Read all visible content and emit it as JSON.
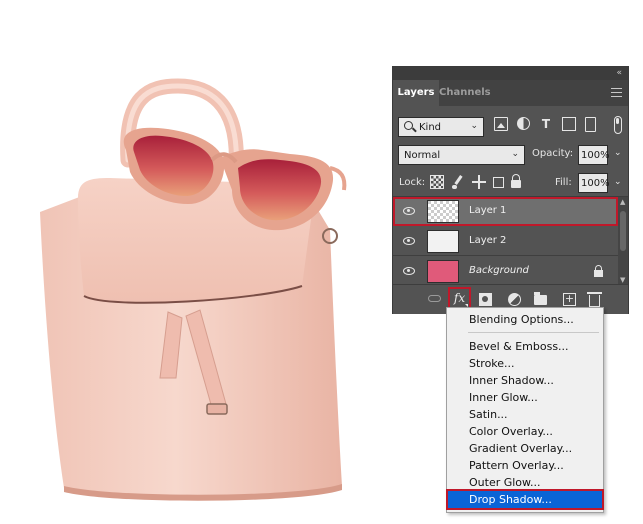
{
  "panel": {
    "tabs": [
      {
        "label": "Layers",
        "active": true
      },
      {
        "label": "Channels",
        "active": false
      }
    ]
  },
  "filter": {
    "kind_label": "Kind"
  },
  "blend": {
    "mode": "Normal",
    "opacity_label": "Opacity:",
    "opacity_value": "100%"
  },
  "lock": {
    "label": "Lock:",
    "fill_label": "Fill:",
    "fill_value": "100%"
  },
  "layers": [
    {
      "name": "Layer 1",
      "selected": true,
      "thumbnail": "transparent-checker"
    },
    {
      "name": "Layer 2",
      "selected": false,
      "thumbnail": "white"
    },
    {
      "name": "Background",
      "selected": false,
      "thumbnail": "pink-photo",
      "locked": true
    }
  ],
  "bottom_bar": {
    "fx_label": "fx"
  },
  "fx_menu": {
    "items": [
      "Blending Options...",
      "Bevel & Emboss...",
      "Stroke...",
      "Inner Shadow...",
      "Inner Glow...",
      "Satin...",
      "Color Overlay...",
      "Gradient Overlay...",
      "Pattern Overlay...",
      "Outer Glow...",
      "Drop Shadow..."
    ],
    "highlighted": "Drop Shadow..."
  },
  "colors": {
    "panel_bg": "#535353",
    "selected_layer_bg": "#6f6f6f",
    "highlight_outline": "#c0182a",
    "menu_highlight": "#0a64d6",
    "bag": "#f2c9bd",
    "sunglasses_lens": "#c93a4a"
  }
}
